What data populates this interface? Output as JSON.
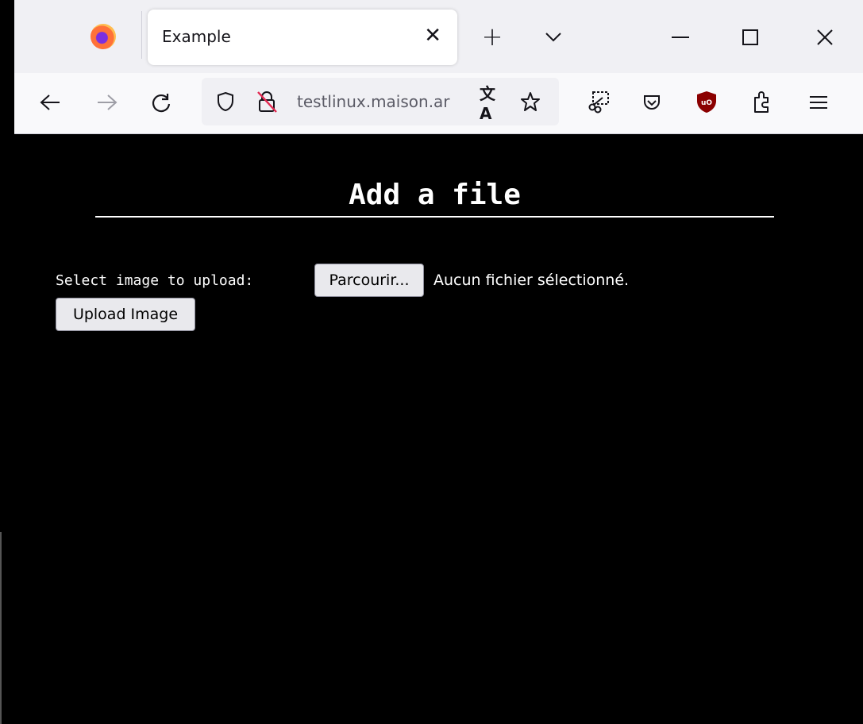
{
  "browser": {
    "tab_title": "Example",
    "tab_close": "✕",
    "new_tab": "+",
    "tab_list": "⌄",
    "url": "testlinux.maison.ar",
    "window_controls": {
      "minimize": "—",
      "maximize": "☐",
      "close": "✕"
    }
  },
  "page": {
    "heading": "Add a file",
    "upload_label": "Select image to upload:",
    "browse_button": "Parcourir...",
    "file_status": "Aucun fichier sélectionné.",
    "upload_button": "Upload Image"
  },
  "colors": {
    "page_bg": "#000000",
    "page_text": "#ffffff",
    "chrome_bg": "#f0f0f4",
    "ublock_red": "#8b0000"
  },
  "icons": [
    "firefox-logo-icon",
    "close-icon",
    "plus-icon",
    "chevron-down-icon",
    "minimize-icon",
    "maximize-icon",
    "window-close-icon",
    "back-icon",
    "forward-icon",
    "reload-icon",
    "shield-icon",
    "insecure-lock-icon",
    "translate-icon",
    "star-icon",
    "screenshot-icon",
    "pocket-icon",
    "ublock-icon",
    "extensions-icon",
    "menu-icon"
  ]
}
